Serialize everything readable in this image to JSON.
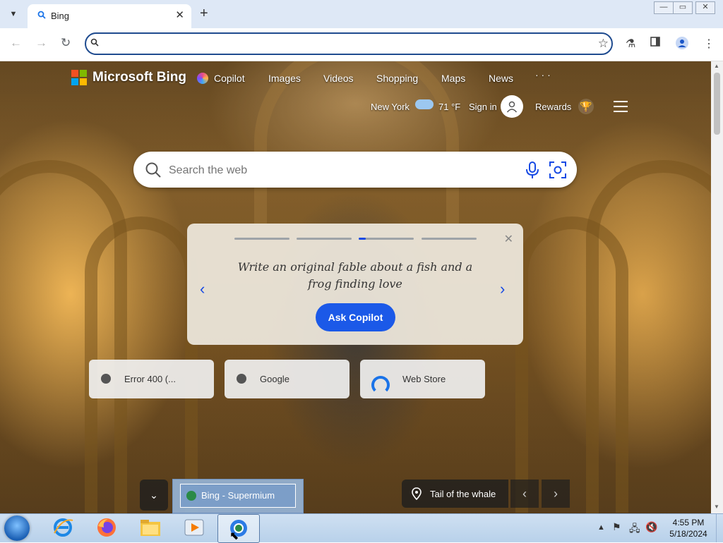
{
  "browser": {
    "tab_title": "Bing",
    "tab_close": "✕",
    "new_tab": "+",
    "address_value": "",
    "window_controls": [
      "—",
      "▭",
      "✕"
    ]
  },
  "bing": {
    "logo_text": "Microsoft Bing",
    "nav": [
      "Copilot",
      "Images",
      "Videos",
      "Shopping",
      "Maps",
      "News",
      "· · ·"
    ],
    "weather_city": "New York",
    "weather_temp": "71 °F",
    "signin": "Sign in",
    "rewards": "Rewards",
    "search_placeholder": "Search the web",
    "card": {
      "prompt": "Write an original fable about a fish and a frog finding love",
      "button": "Ask Copilot",
      "active_step": 3,
      "total_steps": 4
    },
    "tiles": [
      {
        "label": "Error 400 (..."
      },
      {
        "label": "Google"
      },
      {
        "label": "Web Store"
      }
    ],
    "caption": "Tail of the whale"
  },
  "taskbar": {
    "popup_title": "Bing - Supermium",
    "time": "4:55 PM",
    "date": "5/18/2024"
  },
  "colors": {
    "accent": "#174ae4",
    "ms_red": "#f25022",
    "ms_green": "#7fba00",
    "ms_blue": "#00a4ef",
    "ms_yellow": "#ffb900"
  }
}
